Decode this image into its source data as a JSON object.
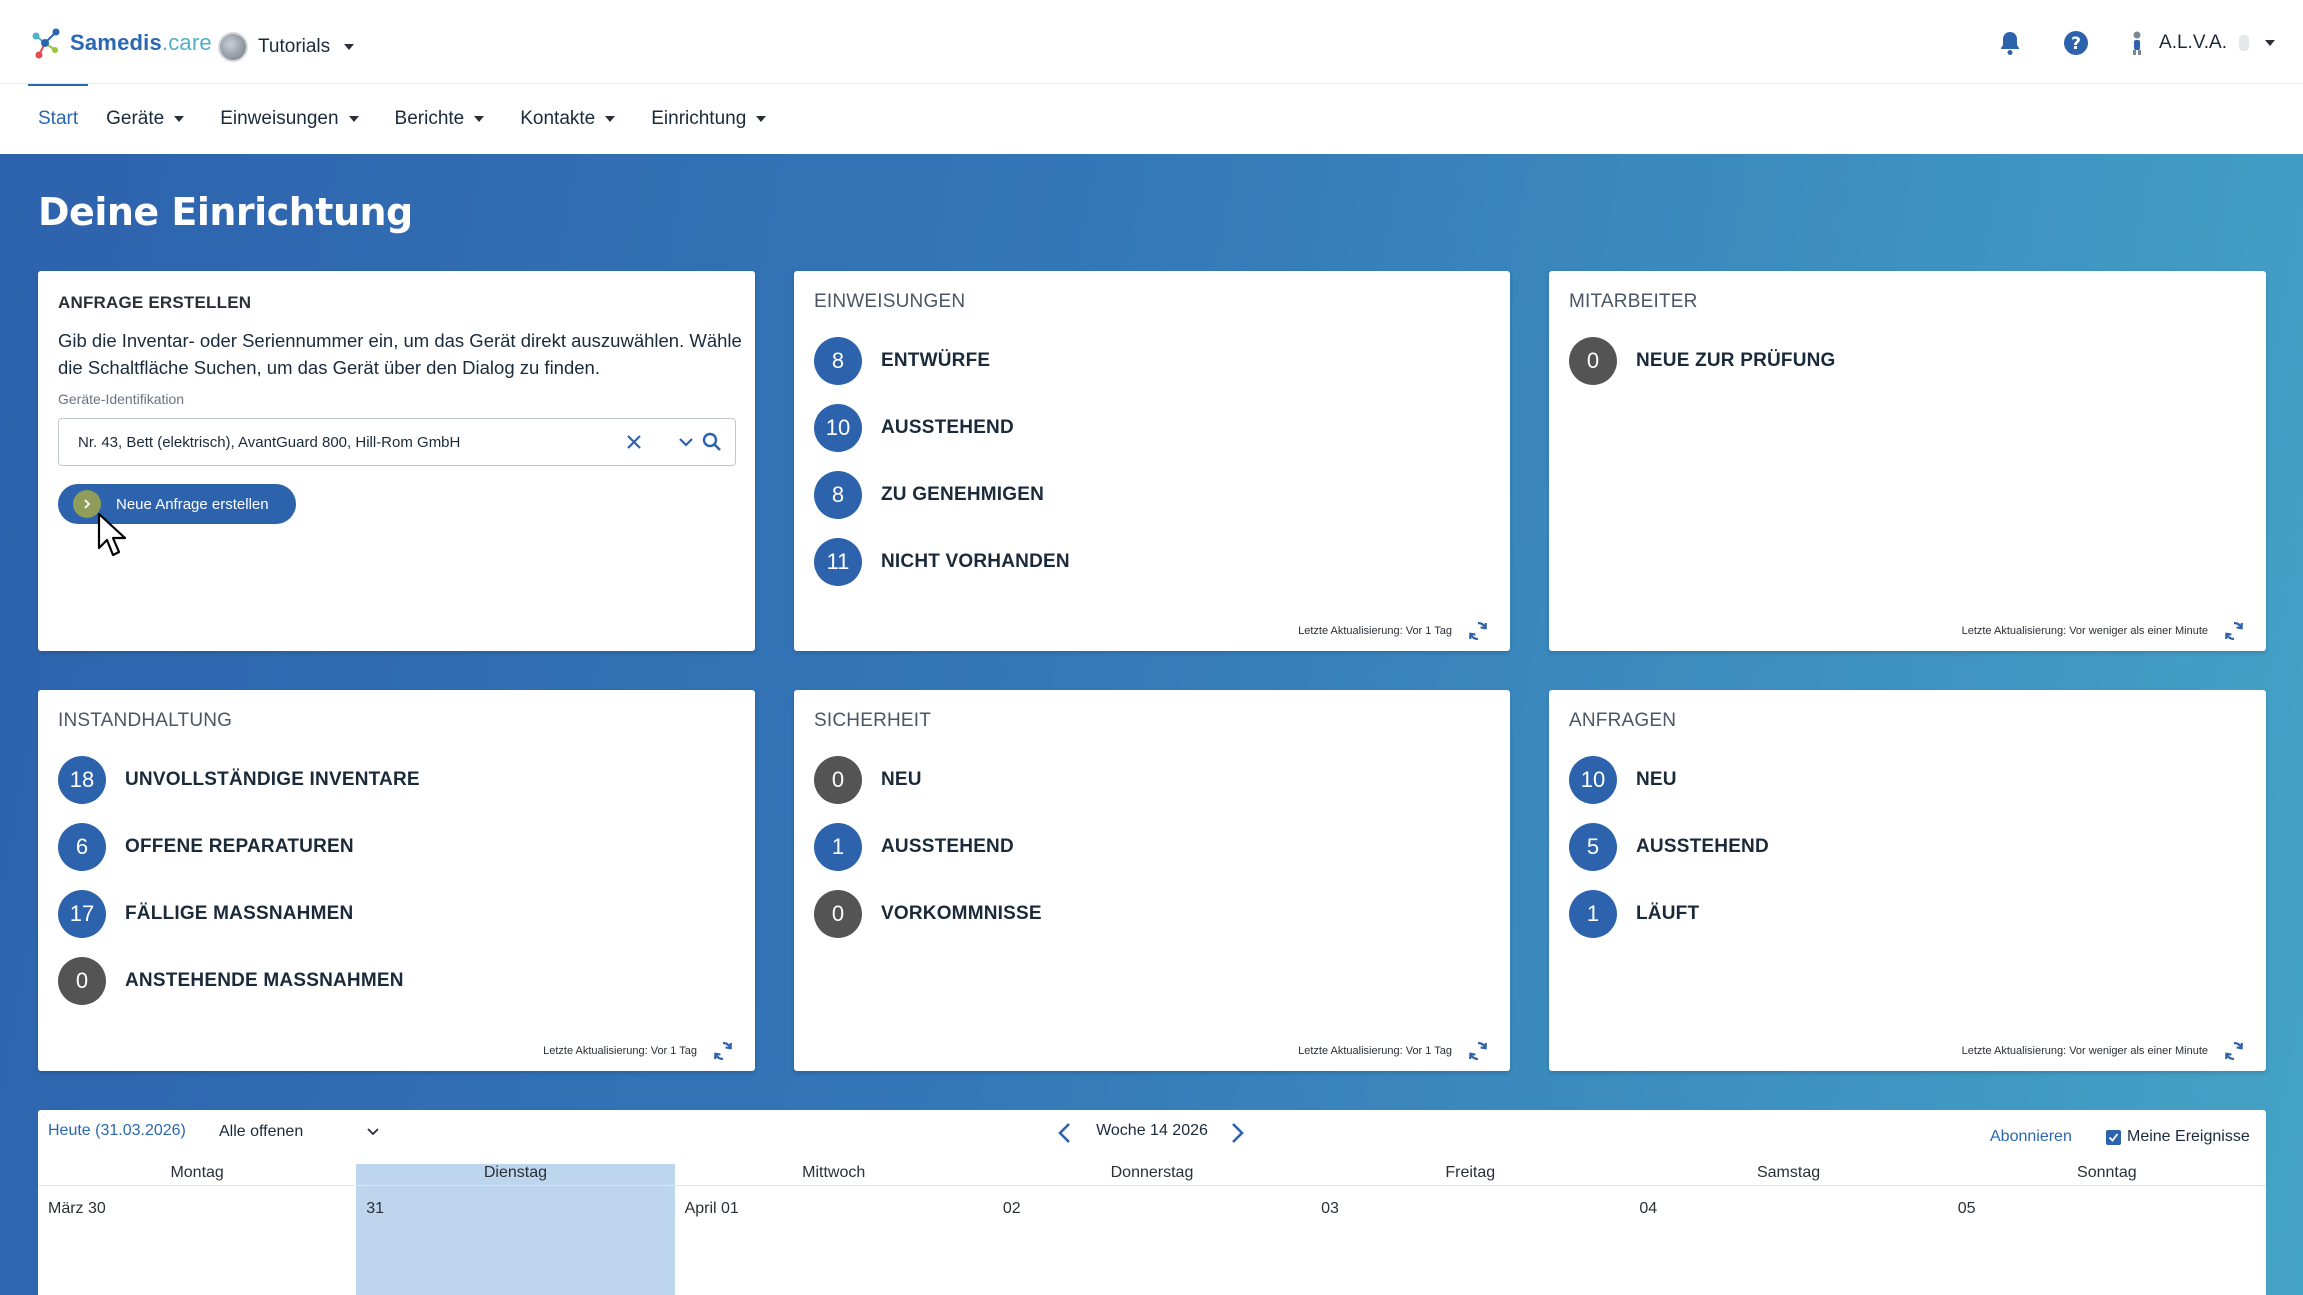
{
  "header": {
    "logo_brand": "Samedis",
    "logo_suffix": ".care",
    "tenant": "Tutorials",
    "user": "A.L.V.A."
  },
  "nav": {
    "items": [
      "Start",
      "Geräte",
      "Einweisungen",
      "Berichte",
      "Kontakte",
      "Einrichtung"
    ]
  },
  "page": {
    "title": "Deine Einrichtung"
  },
  "request_card": {
    "title": "ANFRAGE ERSTELLEN",
    "description": "Gib die Inventar- oder Seriennummer ein, um das Gerät direkt auszuwählen. Wähle die Schaltfläche Suchen, um das Gerät über den Dialog zu finden.",
    "field_label": "Geräte-Identifikation",
    "field_value": "Nr. 43, Bett (elektrisch), AvantGuard 800, Hill-Rom GmbH",
    "button_label": "Neue Anfrage erstellen"
  },
  "cards": {
    "einweisungen": {
      "title": "EINWEISUNGEN",
      "items": [
        {
          "count": "8",
          "label": "ENTWÜRFE"
        },
        {
          "count": "10",
          "label": "AUSSTEHEND"
        },
        {
          "count": "8",
          "label": "ZU GENEHMIGEN"
        },
        {
          "count": "11",
          "label": "NICHT VORHANDEN"
        }
      ],
      "updated": "Letzte Aktualisierung: Vor 1 Tag"
    },
    "mitarbeiter": {
      "title": "MITARBEITER",
      "items": [
        {
          "count": "0",
          "label": "NEUE ZUR PRÜFUNG"
        }
      ],
      "updated": "Letzte Aktualisierung: Vor weniger als einer Minute"
    },
    "instandhaltung": {
      "title": "INSTANDHALTUNG",
      "items": [
        {
          "count": "18",
          "label": "UNVOLLSTÄNDIGE INVENTARE"
        },
        {
          "count": "6",
          "label": "OFFENE REPARATUREN"
        },
        {
          "count": "17",
          "label": "FÄLLIGE MASSNAHMEN"
        },
        {
          "count": "0",
          "label": "ANSTEHENDE MASSNAHMEN"
        }
      ],
      "updated": "Letzte Aktualisierung: Vor 1 Tag"
    },
    "sicherheit": {
      "title": "SICHERHEIT",
      "items": [
        {
          "count": "0",
          "label": "NEU"
        },
        {
          "count": "1",
          "label": "AUSSTEHEND"
        },
        {
          "count": "0",
          "label": "VORKOMMNISSE"
        }
      ],
      "updated": "Letzte Aktualisierung: Vor 1 Tag"
    },
    "anfragen": {
      "title": "ANFRAGEN",
      "items": [
        {
          "count": "10",
          "label": "NEU"
        },
        {
          "count": "5",
          "label": "AUSSTEHEND"
        },
        {
          "count": "1",
          "label": "LÄUFT"
        }
      ],
      "updated": "Letzte Aktualisierung: Vor weniger als einer Minute"
    }
  },
  "calendar": {
    "today": "Heute (31.03.2026)",
    "filter": "Alle offenen",
    "week": "Woche 14 2026",
    "subscribe": "Abonnieren",
    "my_events": "Meine Ereignisse",
    "weekdays": [
      "Montag",
      "Dienstag",
      "Mittwoch",
      "Donnerstag",
      "Freitag",
      "Samstag",
      "Sonntag"
    ],
    "dates": [
      "März 30",
      "31",
      "April 01",
      "02",
      "03",
      "04",
      "05"
    ]
  },
  "colors": {
    "primary": "#2d62ad",
    "badge_zero": "#545454",
    "highlight_day": "#bed5ee"
  }
}
